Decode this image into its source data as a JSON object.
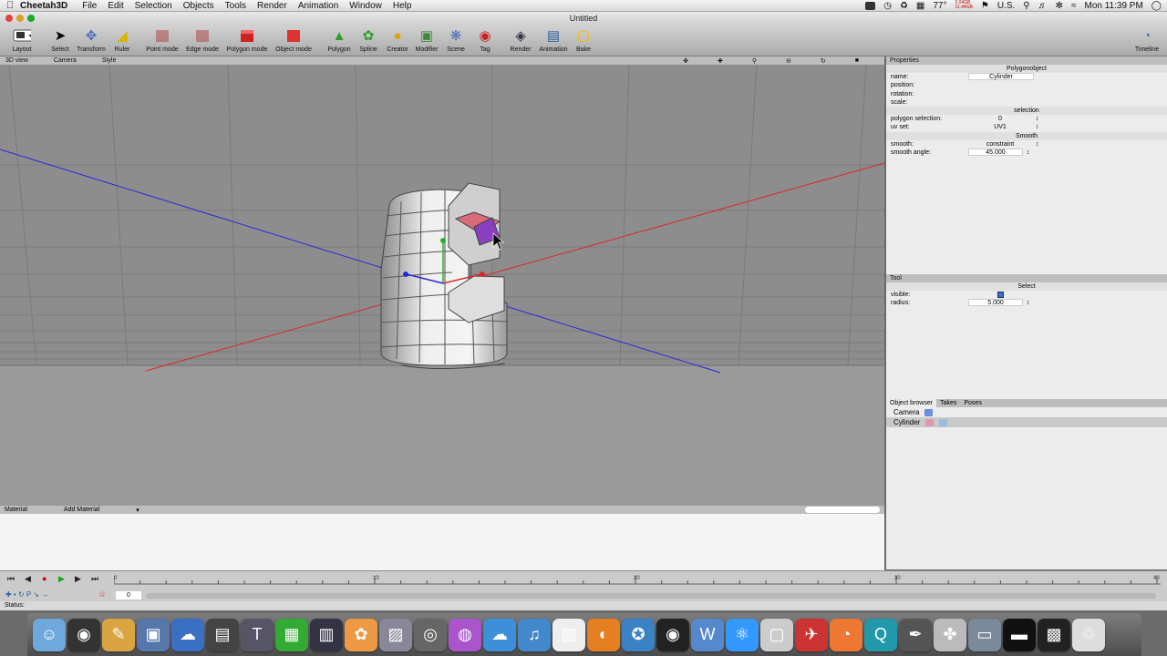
{
  "menubar": {
    "app_name": "Cheetah3D",
    "items": [
      "File",
      "Edit",
      "Selection",
      "Objects",
      "Tools",
      "Render",
      "Animation",
      "Window",
      "Help"
    ],
    "temperature": "77°",
    "memory_top": "2.04GB",
    "memory_bottom": "11.44GB",
    "input_source": "U.S.",
    "clock": "Mon 11:39 PM"
  },
  "window": {
    "title": "Untitled"
  },
  "toolbar": {
    "layout": "Layout",
    "select": "Select",
    "transform": "Transform",
    "ruler": "Ruler",
    "point_mode": "Point mode",
    "edge_mode": "Edge mode",
    "polygon_mode": "Polygon mode",
    "object_mode": "Object mode",
    "polygon": "Polygon",
    "spline": "Spline",
    "creator": "Creator",
    "modifier": "Modifier",
    "scene": "Scene",
    "tag": "Tag",
    "render": "Render",
    "animation": "Animation",
    "bake": "Bake",
    "timeline": "Timeline"
  },
  "view": {
    "name": "3D view",
    "camera": "Camera",
    "style": "Style"
  },
  "properties": {
    "header": "Properties",
    "object_type": "Polygonobject",
    "name_label": "name:",
    "name_value": "Cylinder",
    "position_label": "position:",
    "rotation_label": "rotation:",
    "scale_label": "scale:",
    "selection_title": "selection",
    "polygon_selection_label": "polygon selection:",
    "polygon_selection_value": "0",
    "uv_set_label": "uv set:",
    "uv_set_value": "UV1",
    "smooth_title": "Smooth",
    "smooth_label": "smooth:",
    "smooth_value": "constraint",
    "smooth_angle_label": "smooth angle:",
    "smooth_angle_value": "45.000"
  },
  "tool": {
    "header": "Tool",
    "name": "Select",
    "visible_label": "visible:",
    "radius_label": "radius:",
    "radius_value": "5.000"
  },
  "object_browser": {
    "tabs": [
      "Object browser",
      "Takes",
      "Poses"
    ],
    "objects": [
      "Camera",
      "Cylinder"
    ]
  },
  "material": {
    "header": "Material",
    "add": "Add Material"
  },
  "timeline": {
    "frame": "0",
    "ticks": [
      "0",
      "10",
      "20",
      "30",
      "40"
    ],
    "status": "Status:"
  },
  "dock": {
    "apps": [
      "finder-icon",
      "dashboard-icon",
      "textedit-icon",
      "photo-icon",
      "cloud-icon",
      "clapper-icon",
      "text-tool-icon",
      "film-icon",
      "ram-icon",
      "colors-icon",
      "gallery-icon",
      "dvd-icon",
      "rainbow-icon",
      "weather-icon",
      "itunes-icon",
      "preview-icon",
      "firefox-icon",
      "safari-icon",
      "camera-icon",
      "word-icon",
      "atom-icon",
      "dvd-player-icon",
      "hairdryer-icon",
      "spiral-icon",
      "qtc-icon",
      "pen-icon",
      "paw-icon",
      "folder-icon",
      "terminal-icon",
      "screen-icon",
      "trash-icon"
    ]
  }
}
